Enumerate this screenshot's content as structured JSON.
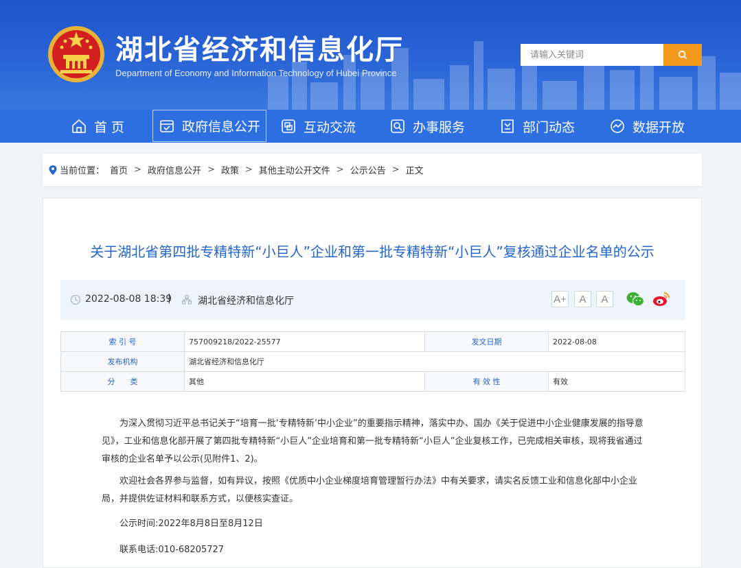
{
  "header": {
    "title": "湖北省经济和信息化厅",
    "subtitle": "Department of Economy and Information Technology of Hubei Province",
    "search_placeholder": "请输入关键词",
    "accent": "#f39a1c"
  },
  "nav": {
    "items": [
      {
        "label": "首 页",
        "icon": "home-icon"
      },
      {
        "label": "政府信息公开",
        "icon": "document-check-icon"
      },
      {
        "label": "互动交流",
        "icon": "chat-icon"
      },
      {
        "label": "办事服务",
        "icon": "service-search-icon"
      },
      {
        "label": "部门动态",
        "icon": "news-icon"
      },
      {
        "label": "数据开放",
        "icon": "data-icon"
      }
    ],
    "active_index": 1
  },
  "breadcrumb": {
    "prefix": "当前位置：",
    "items": [
      "首页",
      "政府信息公开",
      "政策",
      "其他主动公开文件",
      "公示公告",
      "正文"
    ],
    "separator": ">"
  },
  "article": {
    "title": "关于湖北省第四批专精特新“小巨人”企业和第一批专精特新“小巨人”复核通过企业名单的公示",
    "date": "2022-08-08 18:39",
    "divider": "|",
    "source": "湖北省经济和信息化厅",
    "font_sizes": [
      "A+",
      "A",
      "A"
    ],
    "info": {
      "index_label": "索 引 号",
      "index_value": "757009218/2022-25577",
      "issue_date_label": "发文日期",
      "issue_date_value": "2022-08-08",
      "org_label": "发布机构",
      "org_value": "湖北省经济和信息化厅",
      "category_label": "分　　类",
      "category_value": "其他",
      "validity_label": "有 效 性",
      "validity_value": "有效"
    },
    "paragraphs": [
      "为深入贯彻习近平总书记关于“培育一批‘专精特新’中小企业”的重要指示精神，落实中办、国办《关于促进中小企业健康发展的指导意见》，工业和信息化部开展了第四批专精特新“小巨人”企业培育和第一批专精特新“小巨人”企业复核工作，已完成相关审核，现将我省通过审核的企业名单予以公示(见附件1、2)。",
      "欢迎社会各界参与监督，如有异议，按照《优质中小企业梯度培育管理暂行办法》中有关要求，请实名反馈工业和信息化部中小企业局，并提供佐证材料和联系方式，以便核实查证。",
      "公示时间:2022年8月8日至8月12日",
      "联系电话:010-68205727"
    ]
  }
}
